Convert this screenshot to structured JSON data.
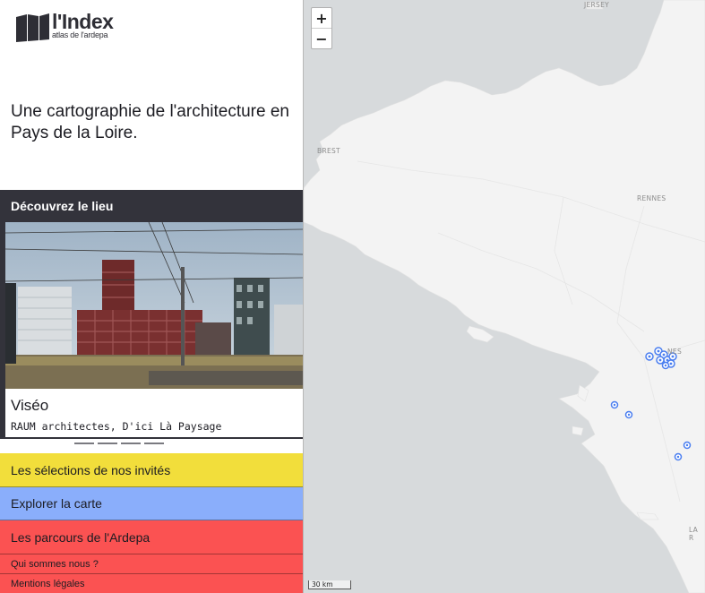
{
  "brand": {
    "title": "l'Index",
    "subtitle": "atlas de l'ardepa",
    "tagline": "Une cartographie de l'architecture en Pays de la Loire."
  },
  "discover": {
    "heading": "Découvrez le lieu",
    "place_name": "Viséo",
    "architects": "RAUM architectes, D'ici Là Paysage",
    "slides_total": 5,
    "active_slide": 1
  },
  "nav": {
    "selections": "Les sélections de nos invités",
    "explore": "Explorer la carte",
    "parcours": "Les parcours de l'Ardepa",
    "about": "Qui sommes nous ?",
    "legal": "Mentions légales"
  },
  "map": {
    "zoom_in": "+",
    "zoom_out": "−",
    "cities": [
      "JERSEY",
      "BREST",
      "RENNES",
      "NES",
      "LA R"
    ],
    "scale_label": "30 km"
  },
  "colors": {
    "dark": "#33333b",
    "yellow": "#f2de3b",
    "blue": "#8aaefb",
    "red": "#fb5252",
    "marker": "#4a7ef0",
    "sea": "#d7dadc",
    "land": "#f3f3f3"
  }
}
